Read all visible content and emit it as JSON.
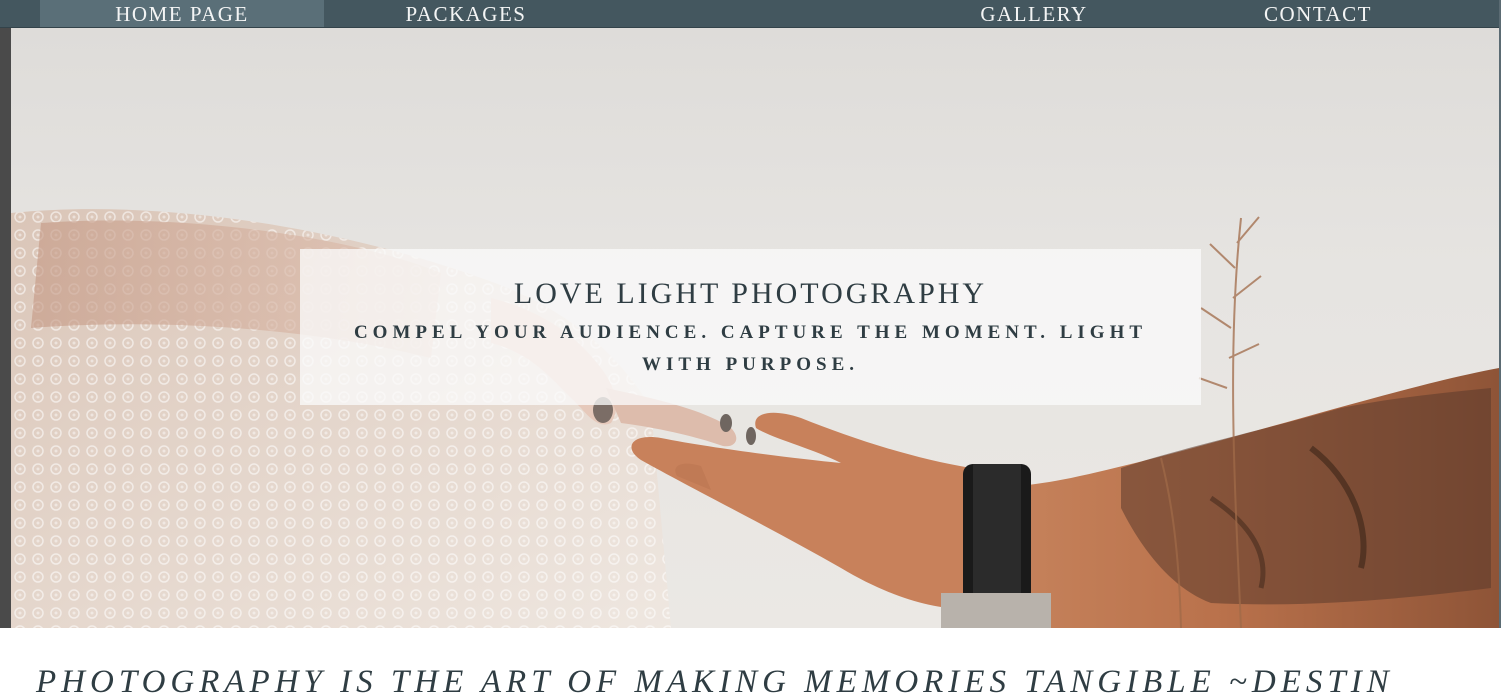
{
  "nav": {
    "items": [
      {
        "label": "HOME PAGE",
        "active": true
      },
      {
        "label": "PACKAGES",
        "active": false
      },
      {
        "label": "GALLERY",
        "active": false
      },
      {
        "label": "CONTACT",
        "active": false
      }
    ]
  },
  "hero": {
    "title": "LOVE LIGHT PHOTOGRAPHY",
    "subtitle": "COMPEL YOUR AUDIENCE. CAPTURE THE MOMENT. LIGHT WITH PURPOSE.",
    "image_icon": "reaching-hands-photo"
  },
  "quote": {
    "text": "PHOTOGRAPHY IS THE ART OF MAKING MEMORIES TANGIBLE ~DESTIN"
  },
  "colors": {
    "nav_bg": "#44575f",
    "nav_active": "#5a6f78",
    "text_dark": "#2f3d43"
  }
}
